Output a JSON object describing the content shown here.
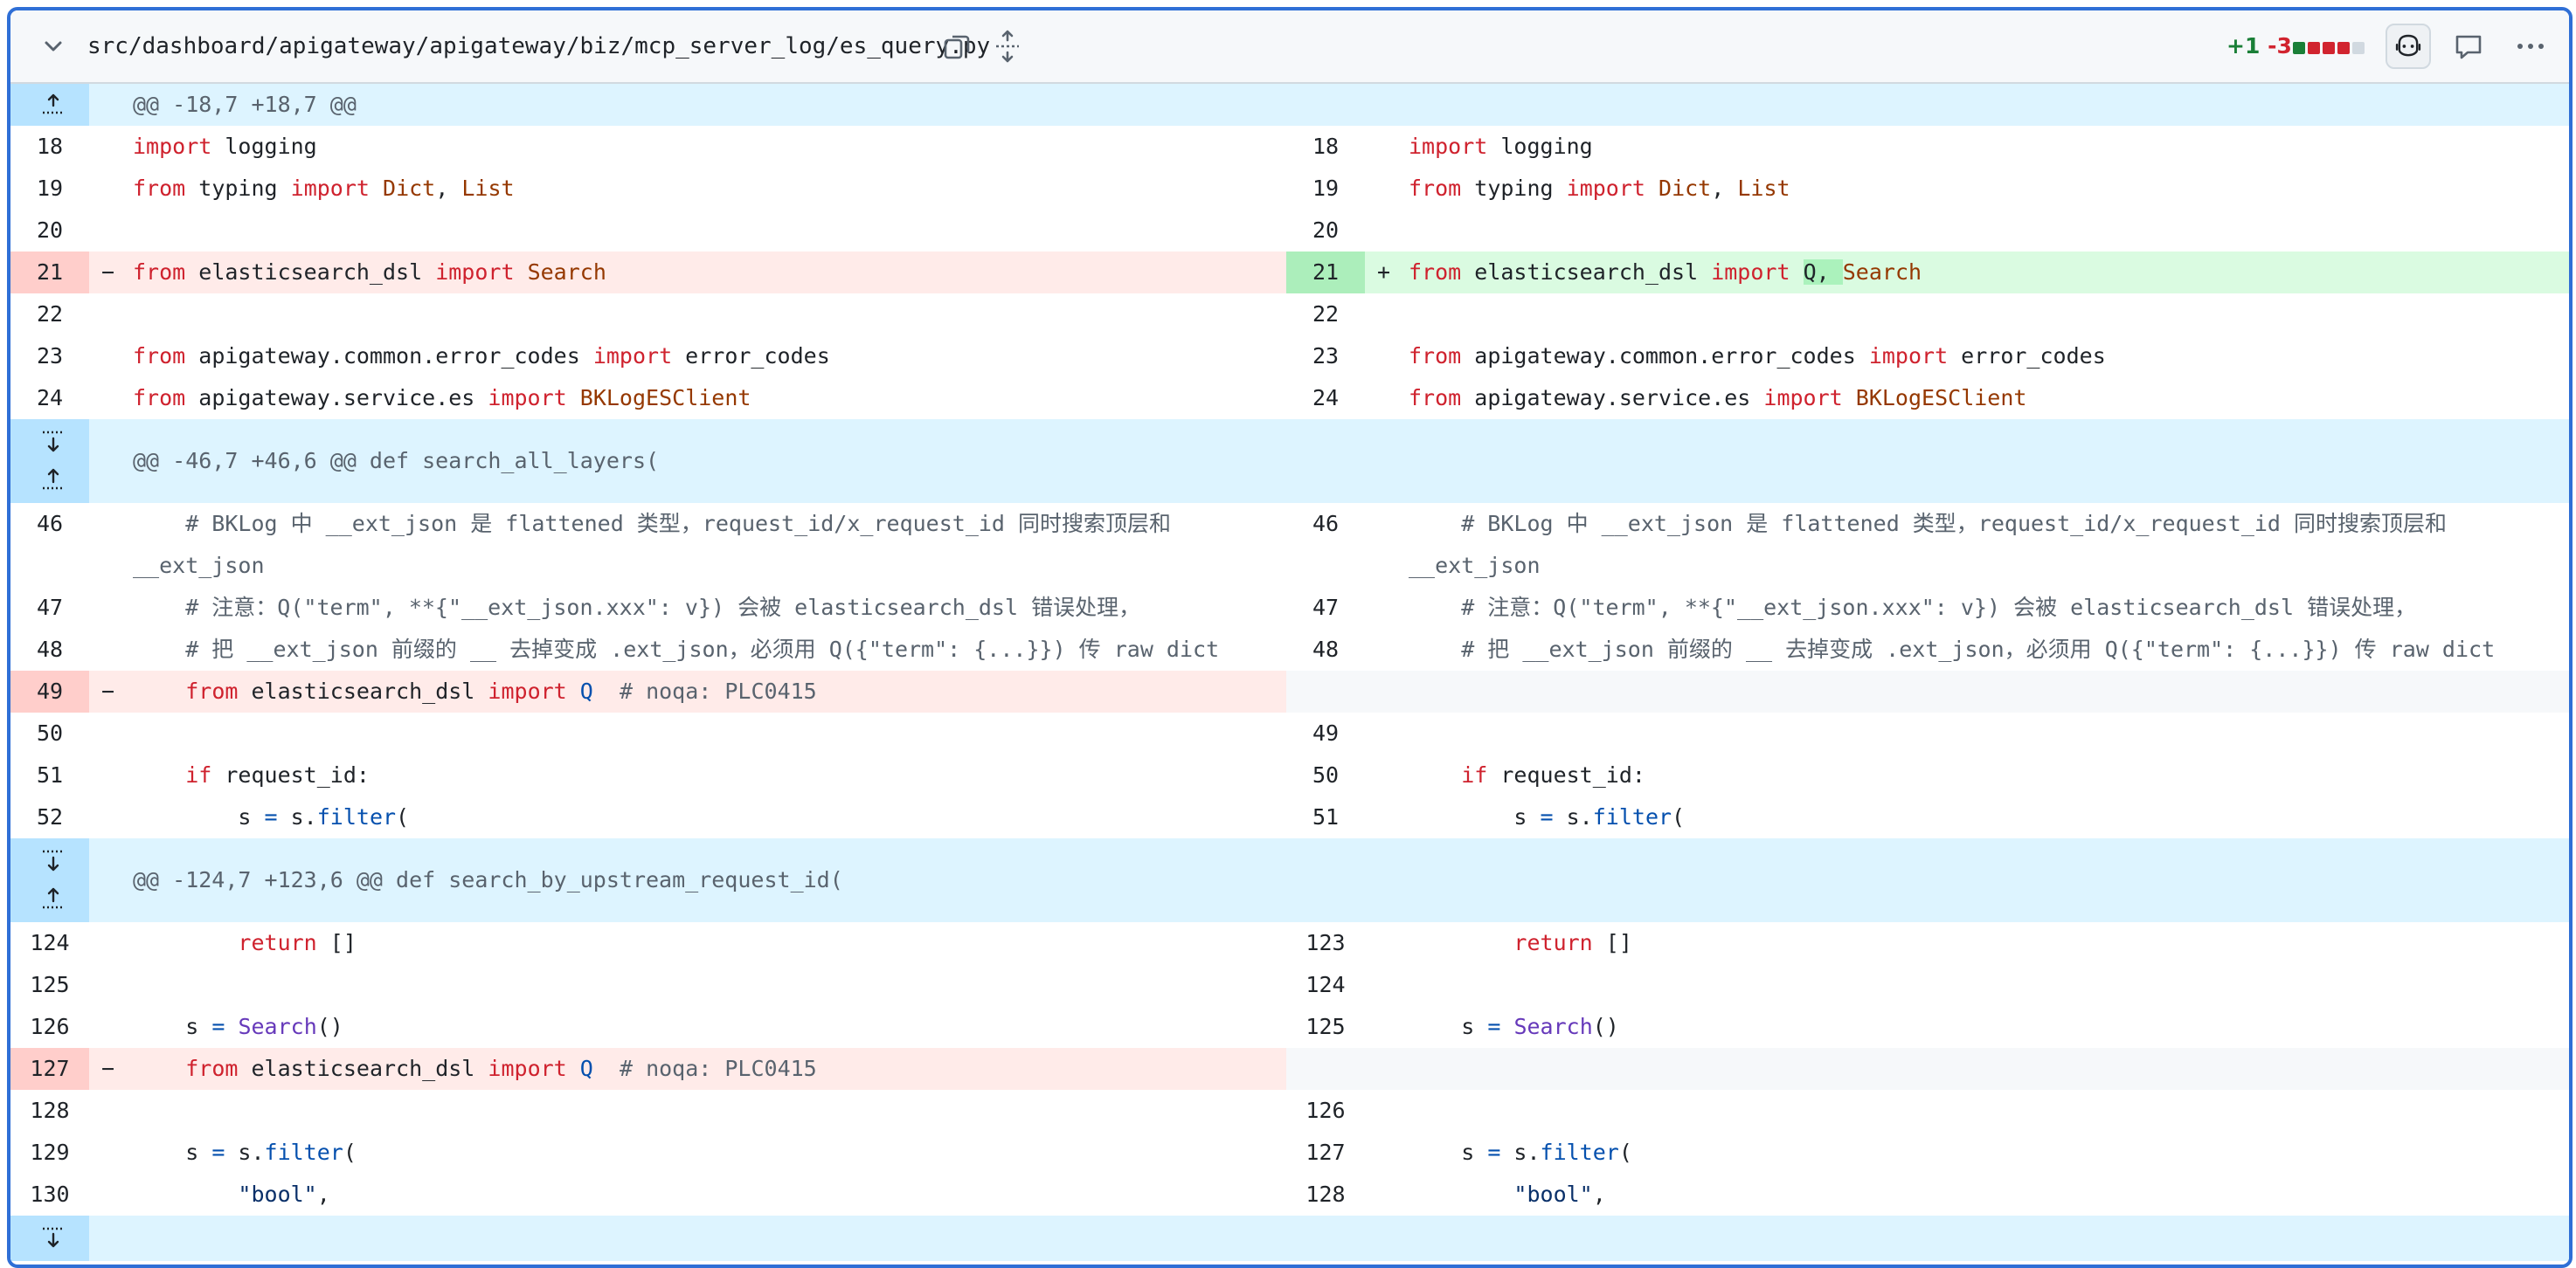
{
  "file": {
    "path": "src/dashboard/apigateway/apigateway/biz/mcp_server_log/es_query.py",
    "additions": "+1",
    "deletions": "-3",
    "diffstat_colors": [
      "#1a7f37",
      "#d1242f",
      "#d1242f",
      "#d1242f",
      "#d1d9e0"
    ]
  },
  "icons": [
    "chevron-down-icon",
    "copy-icon",
    "expand-all-icon",
    "copilot-icon",
    "comment-icon",
    "kebab-icon"
  ],
  "colors": {
    "hunk_bg": "#ddf4ff",
    "hunk_gutter": "#b6e3ff",
    "del_bg": "#ffebe9",
    "del_gutter": "#ffcecb",
    "add_bg": "#dafbe1",
    "add_gutter": "#aceebb",
    "empty_bg": "#f6f8fa",
    "focus_border": "#2f6fd6"
  },
  "hunks": [
    "@@ -18,7 +18,7 @@",
    "@@ -46,7 +46,6 @@ def search_all_layers(",
    "@@ -124,7 +123,6 @@ def search_by_upstream_request_id("
  ],
  "line_numbers": {
    "left": [
      "18",
      "19",
      "20",
      "21",
      "22",
      "23",
      "24",
      "46",
      "47",
      "48",
      "49",
      "50",
      "51",
      "52",
      "124",
      "125",
      "126",
      "127",
      "128",
      "129",
      "130"
    ],
    "right": [
      "18",
      "19",
      "20",
      "21",
      "22",
      "23",
      "24",
      "46",
      "47",
      "48",
      "49",
      "50",
      "51",
      "123",
      "124",
      "125",
      "126",
      "127",
      "128"
    ]
  },
  "code": {
    "import_logging": "import logging",
    "from_typing": "from typing import Dict, List",
    "del_search": "from elasticsearch_dsl import Search",
    "add_q_search": "from elasticsearch_dsl import Q, Search",
    "error_codes": "from apigateway.common.error_codes import error_codes",
    "service_es": "from apigateway.service.es import BKLogESClient",
    "comment1a": "    # BKLog 中 __ext_json 是 flattened 类型，request_id/x_request_id 同时搜索顶层和",
    "comment1b": "__ext_json",
    "comment2": "    # 注意：Q(\"term\", **{\"__ext_json.xxx\": v}) 会被 elasticsearch_dsl 错误处理，",
    "comment3": "    # 把 __ext_json 前缀的 __ 去掉变成 .ext_json，必须用 Q({\"term\": {...}}) 传 raw dict",
    "del_import_q": "    from elasticsearch_dsl import Q  # noqa: PLC0415",
    "if_request_id": "    if request_id:",
    "s_filter_indent": "        s = s.filter(",
    "return_list": "        return []",
    "s_search": "    s = Search()",
    "s_filter": "    s = s.filter(",
    "bool_str": "        \"bool\","
  },
  "markers": {
    "del": "−",
    "add": "+"
  }
}
